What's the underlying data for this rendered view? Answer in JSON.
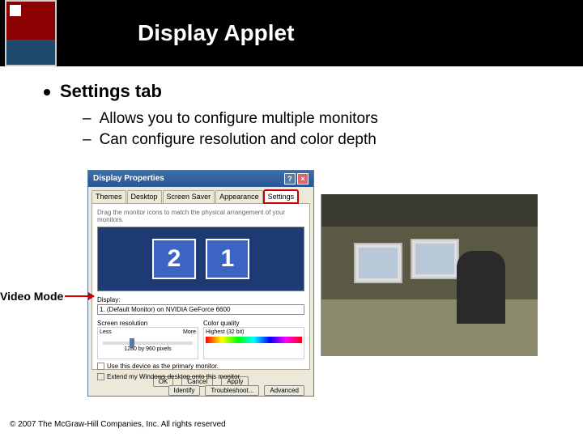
{
  "title": "Display Applet",
  "bullets": {
    "l1": "Settings tab",
    "l2a": "Allows you to configure multiple monitors",
    "l2b": "Can configure resolution and color depth"
  },
  "dialog": {
    "title": "Display Properties",
    "tabs": {
      "themes": "Themes",
      "desktop": "Desktop",
      "screensaver": "Screen Saver",
      "appearance": "Appearance",
      "settings": "Settings"
    },
    "hint": "Drag the monitor icons to match the physical arrangement of your monitors.",
    "monitors": {
      "m1": "2",
      "m2": "1"
    },
    "display_label": "Display:",
    "display_value": "1. (Default Monitor) on NVIDIA GeForce 6600",
    "resolution": {
      "label": "Screen resolution",
      "less": "Less",
      "more": "More",
      "value": "1280 by 960 pixels"
    },
    "color": {
      "label": "Color quality",
      "value": "Highest (32 bit)"
    },
    "chk1": "Use this device as the primary monitor.",
    "chk2": "Extend my Windows desktop onto this monitor.",
    "buttons": {
      "identify": "Identify",
      "troubleshoot": "Troubleshoot...",
      "advanced": "Advanced"
    },
    "bottom": {
      "ok": "OK",
      "cancel": "Cancel",
      "apply": "Apply"
    }
  },
  "video_mode_label": "Video Mode",
  "footer": "© 2007 The McGraw-Hill Companies, Inc. All rights reserved"
}
